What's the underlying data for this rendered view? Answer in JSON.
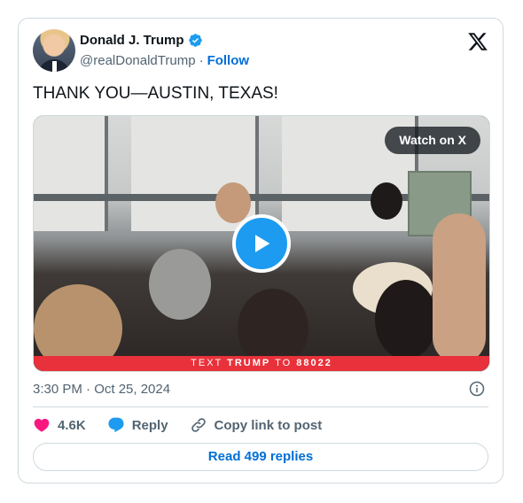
{
  "author": {
    "name": "Donald J. Trump",
    "handle": "@realDonaldTrump",
    "separator": "·",
    "follow_label": "Follow"
  },
  "tweet": {
    "text": "THANK YOU—AUSTIN, TEXAS!",
    "timestamp": "3:30 PM · Oct 25, 2024"
  },
  "media": {
    "watch_label": "Watch on X",
    "banner": {
      "prefix": "TEXT",
      "keyword": "TRUMP",
      "middle": "TO",
      "number": "88022"
    }
  },
  "actions": {
    "like_count": "4.6K",
    "reply_label": "Reply",
    "copy_label": "Copy link to post"
  },
  "read_replies_label": "Read 499 replies",
  "colors": {
    "accent": "#1d9bf0",
    "link": "#006fd6",
    "like": "#f91880",
    "banner": "#e8313a",
    "muted": "#536471"
  }
}
